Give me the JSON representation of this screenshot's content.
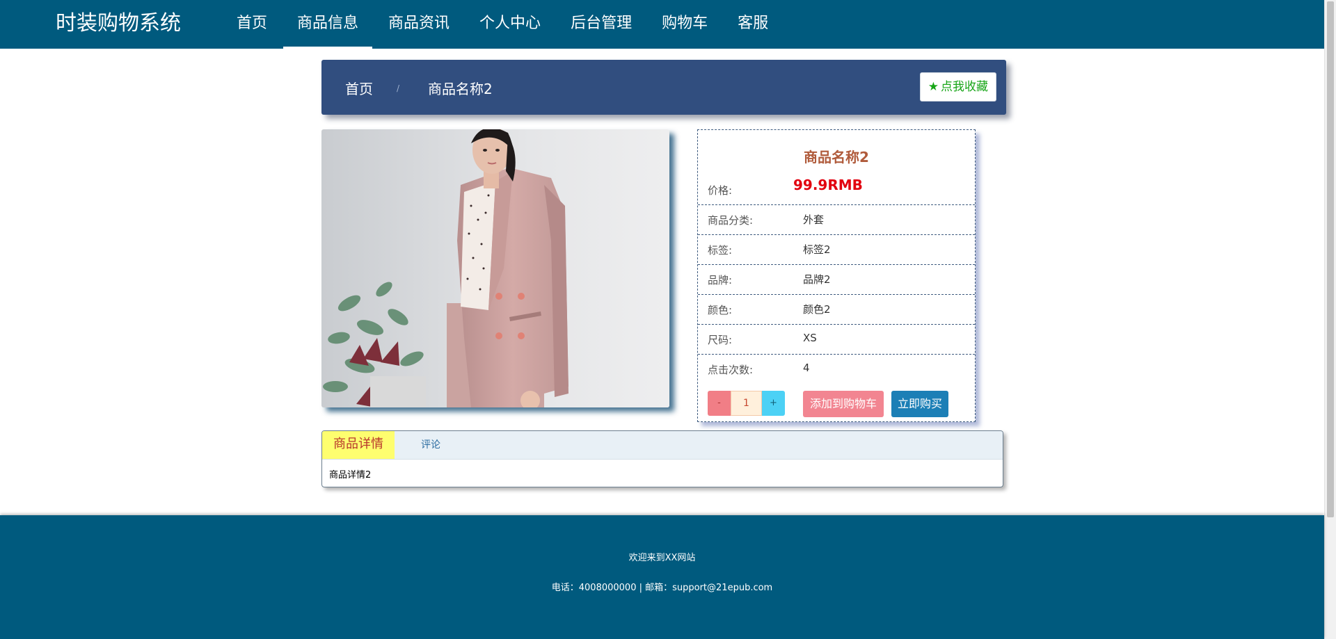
{
  "header": {
    "brand": "时装购物系统",
    "nav": [
      "首页",
      "商品信息",
      "商品资讯",
      "个人中心",
      "后台管理",
      "购物车",
      "客服"
    ],
    "active_nav": "商品信息"
  },
  "breadcrumb": {
    "home": "首页",
    "separator": "/",
    "current": "商品名称2"
  },
  "favorite_button": {
    "icon": "star-icon",
    "label": "点我收藏"
  },
  "product": {
    "image_alt": "woman in pink blazer",
    "name": "商品名称2",
    "price_label": "价格:",
    "price": "99.9RMB",
    "fields": [
      {
        "label": "商品分类:",
        "value": "外套"
      },
      {
        "label": "标签:",
        "value": "标签2"
      },
      {
        "label": "品牌:",
        "value": "品牌2"
      },
      {
        "label": "颜色:",
        "value": "颜色2"
      },
      {
        "label": "尺码:",
        "value": "XS"
      },
      {
        "label": "点击次数:",
        "value": "4"
      }
    ],
    "quantity": {
      "minus": "-",
      "value": "1",
      "plus": "+"
    },
    "add_to_cart": "添加到购物车",
    "buy_now": "立即购买"
  },
  "tabs": {
    "detail": "商品详情",
    "comment": "评论",
    "content": "商品详情2"
  },
  "footer": {
    "welcome": "欢迎来到XX网站",
    "contact": "电话：4008000000 | 邮箱：support@21epub.com"
  },
  "colors": {
    "header_bg": "#005a7e",
    "breadcrumb_bg": "#314e7f",
    "price": "#e2000f",
    "title": "#b05b3b",
    "cart_button": "#f28591",
    "buy_button": "#1c7fb6",
    "tab_active": "#fefe6f"
  }
}
